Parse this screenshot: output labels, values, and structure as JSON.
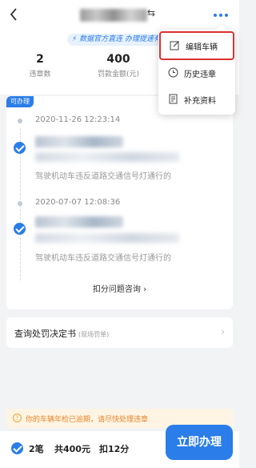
{
  "header": {
    "back_icon": "chevron-left-icon",
    "title_suffix": "⇆",
    "more_icon": "more-dots-icon",
    "accent_color": "#2b7de9"
  },
  "banner": {
    "text": "⚡ 数据官方直连 办理提速有保障"
  },
  "stats": [
    {
      "value": "2",
      "label": "违章数"
    },
    {
      "value": "400",
      "label": "罚款金额(元)"
    }
  ],
  "card": {
    "tag": "可办理",
    "records": [
      {
        "time": "2020-11-26 12:23:14",
        "desc": "驾驶机动车违反道路交通信号灯通行的"
      },
      {
        "time": "2020-07-07 12:08:36",
        "desc": "驾驶机动车违反道路交通信号灯通行的"
      }
    ],
    "consult": "扣分问题咨询 ›"
  },
  "query": {
    "label": "查询处罚决定书",
    "sub": "(现场罚单)",
    "arrow": "›"
  },
  "warning": {
    "icon": "!",
    "text": "你的车辆年检已逾期，请尽快处理违章",
    "color": "#e6862d"
  },
  "bottom": {
    "count": "2笔",
    "amount": "共400元",
    "points": "扣12分",
    "action": "立即办理"
  },
  "menu": {
    "items": [
      {
        "label": "编辑车辆",
        "icon": "edit-icon"
      },
      {
        "label": "历史违章",
        "icon": "clock-icon"
      },
      {
        "label": "补充资料",
        "icon": "document-icon"
      }
    ],
    "highlight_color": "#d9322f"
  }
}
